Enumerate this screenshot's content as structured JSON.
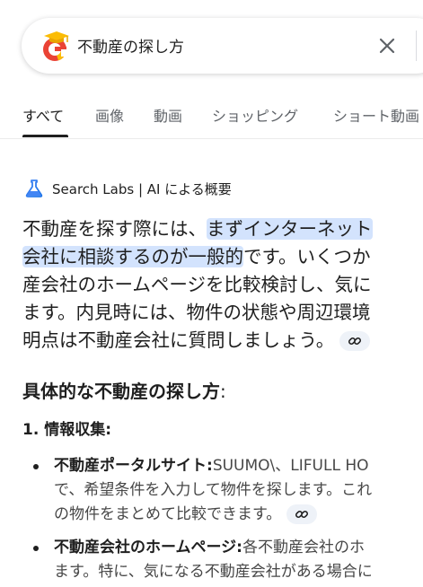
{
  "search": {
    "query": "不動産の探し方"
  },
  "tabs": [
    {
      "label": "すべて"
    },
    {
      "label": "画像"
    },
    {
      "label": "動画"
    },
    {
      "label": "ショッピング"
    },
    {
      "label": "ショート動画"
    }
  ],
  "ai_overview": {
    "header_label": "Search Labs | AI による概要",
    "paragraph": {
      "l1_a": "不動産を探す際には、",
      "l1_hl": "まずインターネット",
      "l2_hl": "会社に相談するのが一般的",
      "l2_b": "です。いくつか",
      "l3": "産会社のホームページを比較検討し、気に",
      "l4": "ます。内見時には、物件の状態や周辺環境",
      "l5": "明点は不動産会社に質問しましょう。"
    },
    "section_title": "具体的な不動産の探し方",
    "section_colon": ":",
    "step1": "1. 情報収集:",
    "items": [
      {
        "bold": "不動産ポータルサイト:",
        "l1": "SUUMO\\、LIFULL HO",
        "l2": "で、希望条件を入力して物件を探します。これ",
        "l3": "の物件をまとめて比較できます。"
      },
      {
        "bold": "不動産会社のホームページ:",
        "l1": "各不動産会社のホ",
        "l2": "ます。特に、気になる不動産会社がある場合に"
      }
    ]
  },
  "colors": {
    "highlight": "#d3e3fd",
    "text": "#1f1f1f",
    "muted": "#5f6368",
    "accent_blue": "#1a73e8",
    "chip_bg": "#eef2f8"
  }
}
